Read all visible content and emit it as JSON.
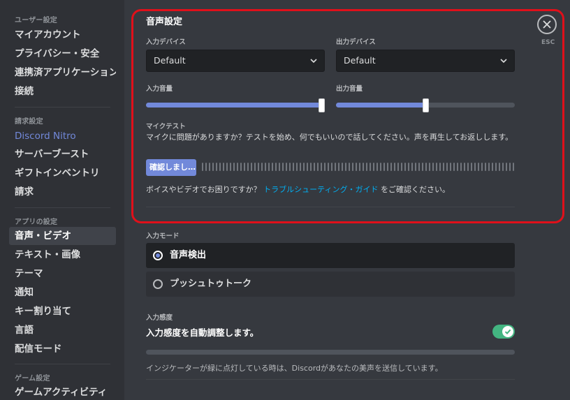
{
  "sidebar": {
    "sections": [
      {
        "header": "ユーザー設定",
        "items": [
          "マイアカウント",
          "プライバシー・安全",
          "連携済アプリケーション",
          "接続"
        ]
      },
      {
        "header": "請求設定",
        "items": [
          "Discord Nitro",
          "サーバーブースト",
          "ギフトインベントリ",
          "請求"
        ]
      },
      {
        "header": "アプリの設定",
        "items": [
          "音声・ビデオ",
          "テキスト・画像",
          "テーマ",
          "通知",
          "キー割り当て",
          "言語",
          "配信モード"
        ]
      },
      {
        "header": "ゲーム設定",
        "items": [
          "ゲームアクティビティ"
        ]
      }
    ],
    "active_item": "音声・ビデオ"
  },
  "voice": {
    "title": "音声設定",
    "input_device_label": "入力デバイス",
    "input_device_value": "Default",
    "output_device_label": "出力デバイス",
    "output_device_value": "Default",
    "input_volume_label": "入力音量",
    "input_volume_percent": 100,
    "output_volume_label": "出力音量",
    "output_volume_percent": 50,
    "mic_test_label": "マイクテスト",
    "mic_test_desc": "マイクに問題がありますか？テストを始め、何でもいいので話してください。声を再生してお返しします。",
    "check_button": "確認しまし…",
    "help_prefix": "ボイスやビデオでお困りですか？",
    "help_link": "トラブルシューティング・ガイド",
    "help_suffix": "をご確認ください。"
  },
  "input_mode": {
    "label": "入力モード",
    "options": [
      "音声検出",
      "プッシュトゥトーク"
    ],
    "selected": "音声検出"
  },
  "sensitivity": {
    "label": "入力感度",
    "auto_label": "入力感度を自動調整します。",
    "auto_enabled": true,
    "note": "インジケーターが緑に点灯している時は、Discordがあなたの美声を送信しています。"
  },
  "close": {
    "esc_label": "ESC"
  },
  "colors": {
    "accent": "#7289da",
    "highlight": "#e0101a",
    "toggle_on": "#43b581",
    "link": "#00b0f4"
  }
}
